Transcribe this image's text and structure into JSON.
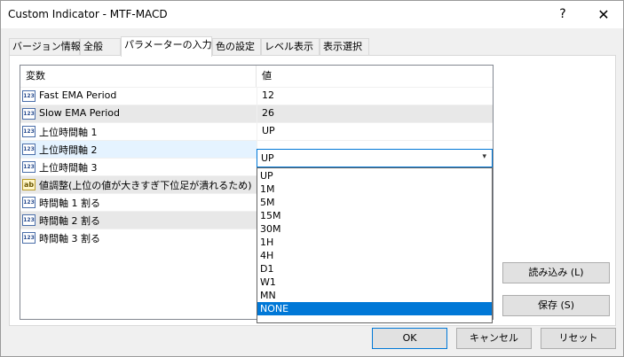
{
  "window": {
    "title": "Custom Indicator - MTF-MACD",
    "help_glyph": "?",
    "close_glyph": "✕"
  },
  "tabs": [
    {
      "label": "バージョン情報"
    },
    {
      "label": "全般"
    },
    {
      "label": "パラメーターの入力",
      "active": true
    },
    {
      "label": "色の設定"
    },
    {
      "label": "レベル表示"
    },
    {
      "label": "表示選択"
    }
  ],
  "grid": {
    "col_variable": "変数",
    "col_value": "値",
    "rows": [
      {
        "icon": "123",
        "name": "Fast EMA Period",
        "value": "12"
      },
      {
        "icon": "123",
        "name": "Slow EMA Period",
        "value": "26"
      },
      {
        "icon": "123",
        "name": "上位時間軸 1",
        "value": "UP"
      },
      {
        "icon": "123",
        "name": "上位時間軸 2",
        "value": "UP"
      },
      {
        "icon": "123",
        "name": "上位時間軸 3",
        "value": ""
      },
      {
        "icon": "ab",
        "name": "値調整(上位の値が大きすぎ下位足が潰れるため)",
        "value": ""
      },
      {
        "icon": "123",
        "name": "時間軸 1 割る",
        "value": ""
      },
      {
        "icon": "123",
        "name": "時間軸 2 割る",
        "value": ""
      },
      {
        "icon": "123",
        "name": "時間軸 3 割る",
        "value": ""
      }
    ]
  },
  "combo": {
    "value": "UP",
    "arrow": "▾"
  },
  "dropdown_options": [
    "UP",
    "1M",
    "5M",
    "15M",
    "30M",
    "1H",
    "4H",
    "D1",
    "W1",
    "MN",
    "NONE"
  ],
  "dropdown_selected": "NONE",
  "buttons": {
    "load": "読み込み (L)",
    "save": "保存 (S)",
    "ok": "OK",
    "cancel": "キャンセル",
    "reset": "リセット"
  }
}
